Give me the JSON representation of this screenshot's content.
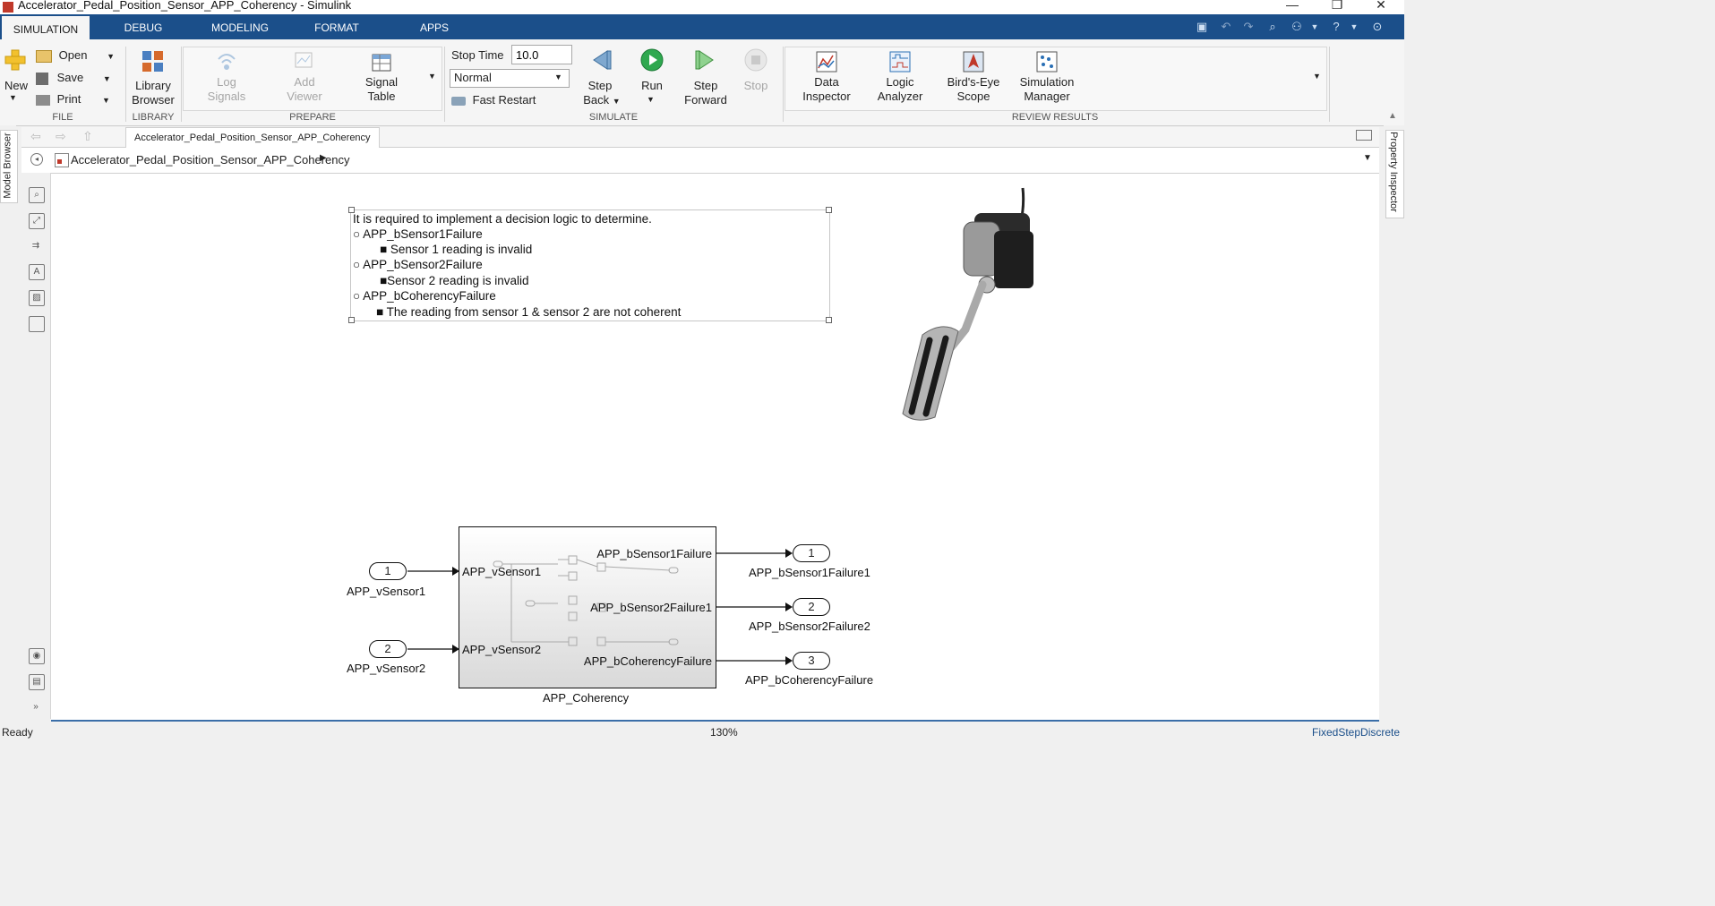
{
  "window": {
    "title": "Accelerator_Pedal_Position_Sensor_APP_Coherency - Simulink",
    "controls": [
      "—",
      "❐",
      "✕"
    ]
  },
  "tabs": [
    "SIMULATION",
    "DEBUG",
    "MODELING",
    "FORMAT",
    "APPS"
  ],
  "ribbon": {
    "file": {
      "new": "New",
      "open": "Open",
      "save": "Save",
      "print": "Print",
      "group": "FILE"
    },
    "library": {
      "line1": "Library",
      "line2": "Browser",
      "group": "LIBRARY"
    },
    "prepare": {
      "log_signals": [
        "Log",
        "Signals"
      ],
      "add_viewer": [
        "Add",
        "Viewer"
      ],
      "signal_table": [
        "Signal",
        "Table"
      ],
      "group": "PREPARE"
    },
    "simulate": {
      "stop_time_label": "Stop Time",
      "stop_time_value": "10.0",
      "mode": "Normal",
      "fast_restart": "Fast Restart",
      "step_back": [
        "Step",
        "Back"
      ],
      "run": "Run",
      "step_forward": [
        "Step",
        "Forward"
      ],
      "stop": "Stop",
      "group": "SIMULATE"
    },
    "review": {
      "data_inspector": [
        "Data",
        "Inspector"
      ],
      "logic_analyzer": [
        "Logic",
        "Analyzer"
      ],
      "birds_eye": [
        "Bird's-Eye",
        "Scope"
      ],
      "sim_manager": [
        "Simulation",
        "Manager"
      ],
      "group": "REVIEW RESULTS"
    }
  },
  "side_tabs": {
    "left": "Model Browser",
    "right": "Property Inspector"
  },
  "doc_tab": "Accelerator_Pedal_Position_Sensor_APP_Coherency",
  "breadcrumb": "Accelerator_Pedal_Position_Sensor_APP_Coherency",
  "annotation": {
    "line1": "It is required to implement a decision logic to determine.",
    "item1": "APP_bSensor1Failure",
    "sub1": "Sensor 1 reading is invalid",
    "item2": "APP_bSensor2Failure",
    "sub2": "Sensor 2 reading is invalid",
    "item3": "APP_bCoherencyFailure",
    "sub3": "The reading from sensor 1 & sensor 2 are not coherent"
  },
  "diagram": {
    "inports": [
      {
        "num": "1",
        "name": "APP_vSensor1"
      },
      {
        "num": "2",
        "name": "APP_vSensor2"
      }
    ],
    "subsystem": {
      "name": "APP_Coherency",
      "in1": "APP_vSensor1",
      "in2": "APP_vSensor2",
      "out1": "APP_bSensor1Failure",
      "out2": "APP_bSensor2Failure1",
      "out3": "APP_bCoherencyFailure"
    },
    "outports": [
      {
        "num": "1",
        "name": "APP_bSensor1Failure1"
      },
      {
        "num": "2",
        "name": "APP_bSensor2Failure2"
      },
      {
        "num": "3",
        "name": "APP_bCoherencyFailure"
      }
    ]
  },
  "status": {
    "left": "Ready",
    "zoom": "130%",
    "solver": "FixedStepDiscrete"
  }
}
